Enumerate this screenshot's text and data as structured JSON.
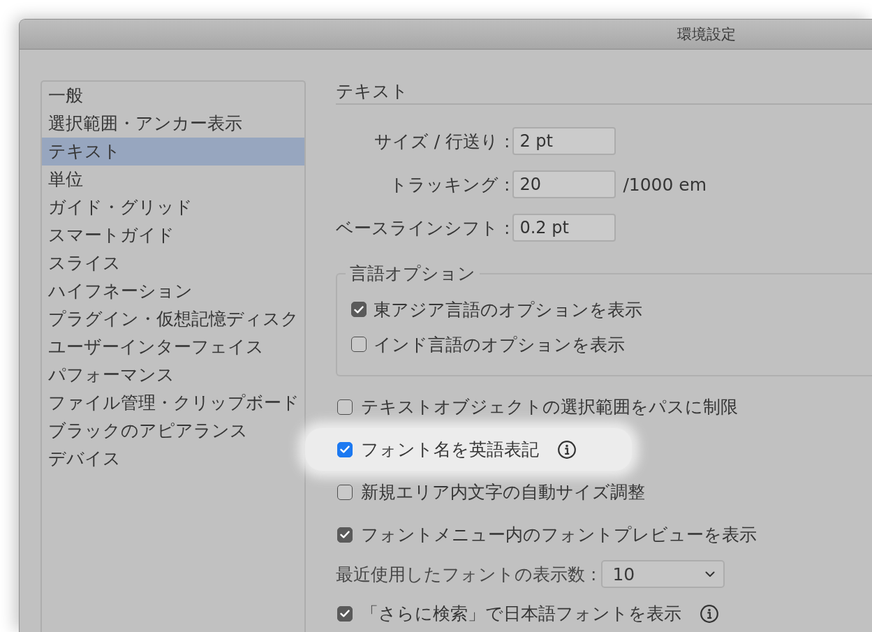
{
  "window": {
    "title": "環境設定"
  },
  "sidebar": {
    "items": [
      {
        "label": "一般",
        "selected": false
      },
      {
        "label": "選択範囲・アンカー表示",
        "selected": false
      },
      {
        "label": "テキスト",
        "selected": true
      },
      {
        "label": "単位",
        "selected": false
      },
      {
        "label": "ガイド・グリッド",
        "selected": false
      },
      {
        "label": "スマートガイド",
        "selected": false
      },
      {
        "label": "スライス",
        "selected": false
      },
      {
        "label": "ハイフネーション",
        "selected": false
      },
      {
        "label": "プラグイン・仮想記憶ディスク",
        "selected": false
      },
      {
        "label": "ユーザーインターフェイス",
        "selected": false
      },
      {
        "label": "パフォーマンス",
        "selected": false
      },
      {
        "label": "ファイル管理・クリップボード",
        "selected": false
      },
      {
        "label": "ブラックのアピアランス",
        "selected": false
      },
      {
        "label": "デバイス",
        "selected": false
      }
    ]
  },
  "panel": {
    "heading": "テキスト",
    "fields": [
      {
        "label": "サイズ / 行送り :",
        "value": "2 pt"
      },
      {
        "label": "トラッキング :",
        "value": "20",
        "unit": "/1000 em"
      },
      {
        "label": "ベースラインシフト :",
        "value": "0.2 pt"
      }
    ],
    "language_options": {
      "legend": "言語オプション",
      "options": [
        {
          "label": "東アジア言語のオプションを表示",
          "checked": true
        },
        {
          "label": "インド言語のオプションを表示",
          "checked": false
        }
      ]
    },
    "options": [
      {
        "kind": "checkbox",
        "label": "テキストオブジェクトの選択範囲をパスに制限",
        "checked": false,
        "highlighted": false,
        "info": false
      },
      {
        "kind": "checkbox",
        "label": "フォント名を英語表記",
        "checked": true,
        "highlighted": true,
        "info": true
      },
      {
        "kind": "checkbox",
        "label": "新規エリア内文字の自動サイズ調整",
        "checked": false,
        "highlighted": false,
        "info": false
      },
      {
        "kind": "checkbox",
        "label": "フォントメニュー内のフォントプレビューを表示",
        "checked": true,
        "highlighted": false,
        "info": false
      },
      {
        "kind": "select",
        "label": "最近使用したフォントの表示数 :",
        "value": "10"
      },
      {
        "kind": "checkbox",
        "label": "「さらに検索」で日本語フォントを表示",
        "checked": true,
        "highlighted": false,
        "info": true
      }
    ]
  }
}
